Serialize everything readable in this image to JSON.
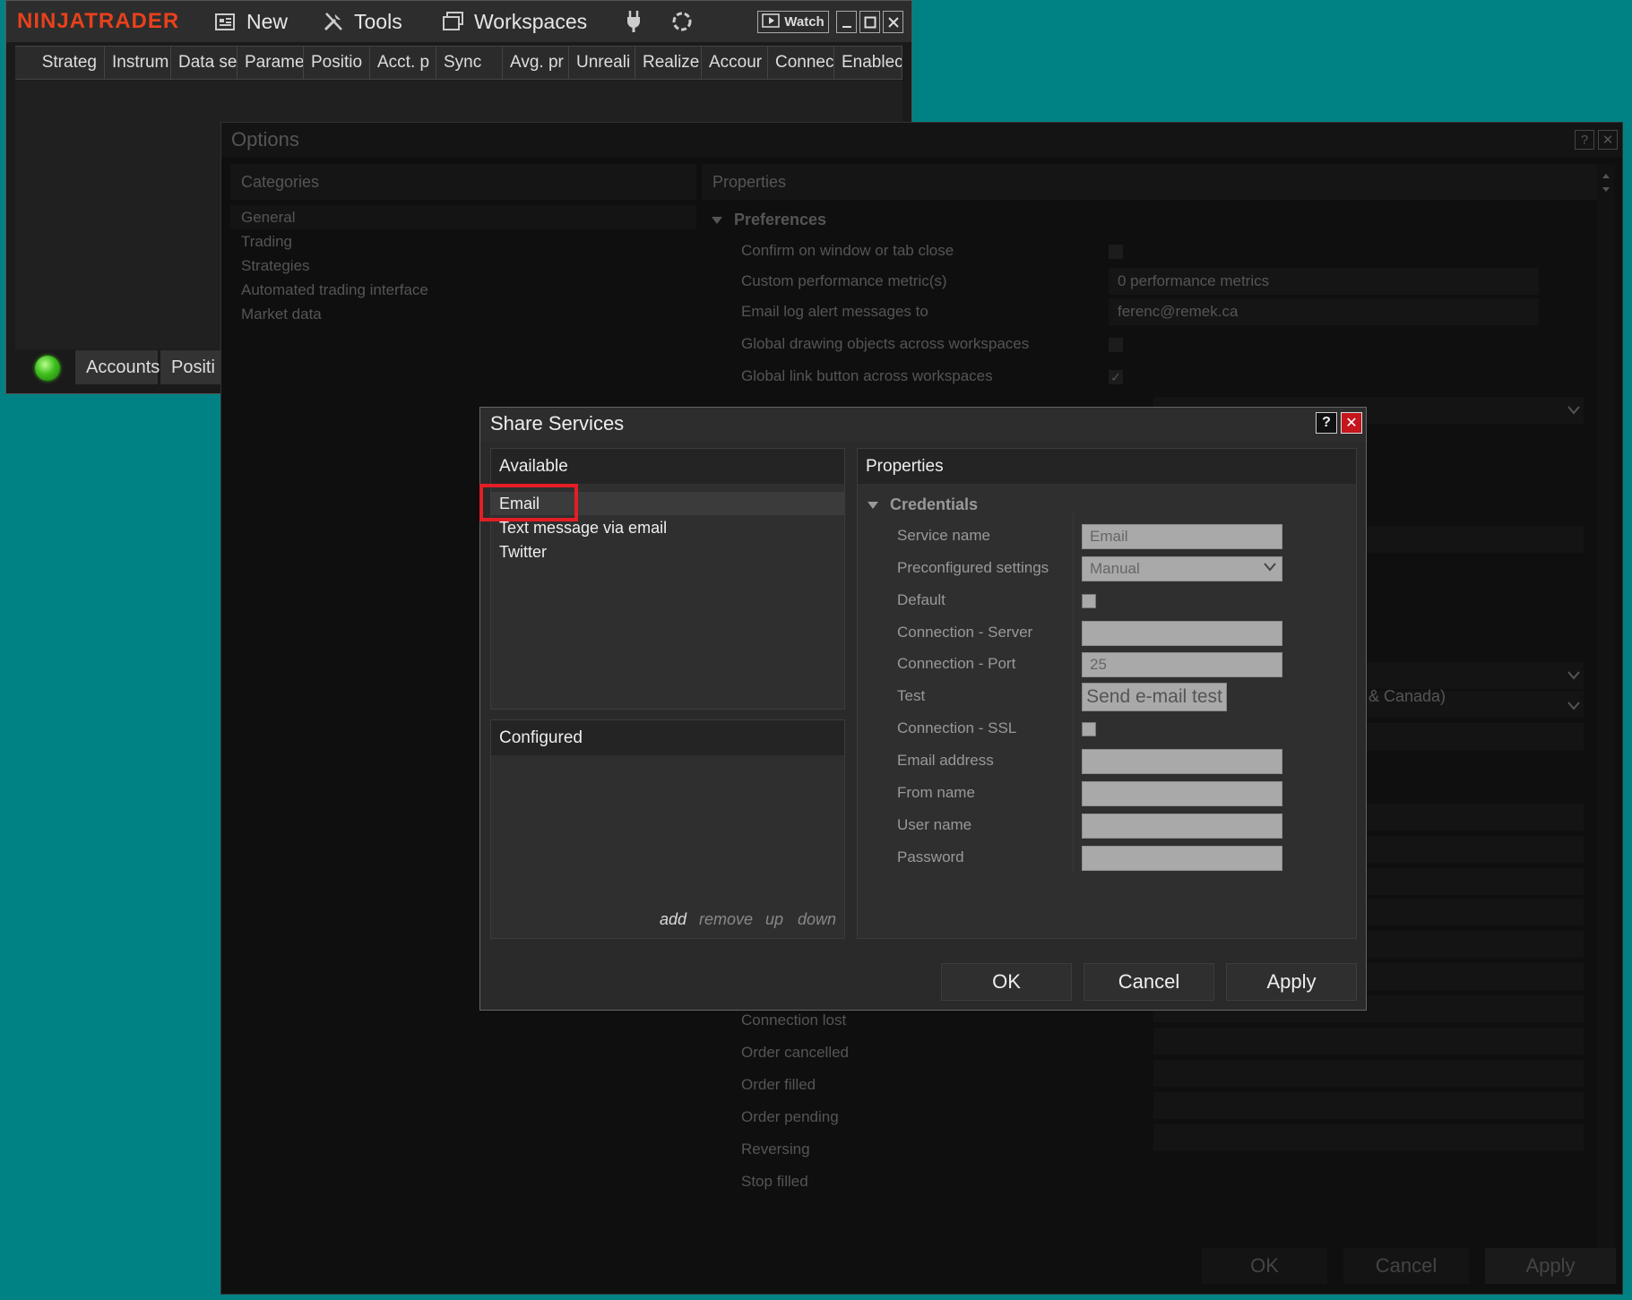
{
  "control_center": {
    "logo": "NINJATRADER",
    "menu": {
      "new": "New",
      "tools": "Tools",
      "workspaces": "Workspaces",
      "watch": "Watch"
    },
    "columns": [
      "Strateg",
      "Instrum",
      "Data se",
      "Parame",
      "Positio",
      "Acct. p",
      "Sync",
      "Avg. pr",
      "Unreali",
      "Realize",
      "Accour",
      "Connec",
      "Enablec"
    ],
    "tabs": [
      "Accounts",
      "Positi"
    ],
    "status_color": "#3fbf1f"
  },
  "options": {
    "title": "Options",
    "help": "?",
    "close": "✕",
    "categories_header": "Categories",
    "categories": [
      "General",
      "Trading",
      "Strategies",
      "Automated trading interface",
      "Market data"
    ],
    "properties_header": "Properties",
    "preferences_group": "Preferences",
    "rows": [
      {
        "label": "Confirm on window or tab close",
        "value": "",
        "type": "check",
        "checked": false
      },
      {
        "label": "Custom performance metric(s)",
        "value": "0 performance metrics",
        "type": "text"
      },
      {
        "label": "Email log alert messages to",
        "value": "ferenc@remek.ca",
        "type": "text"
      },
      {
        "label": "Global drawing objects across workspaces",
        "value": "",
        "type": "check",
        "checked": false
      },
      {
        "label": "Global link button across workspaces",
        "value": "✓",
        "type": "check",
        "checked": true
      }
    ],
    "timezone_fragment": "& Canada)",
    "lower_labels": [
      "Connection lost",
      "Order cancelled",
      "Order filled",
      "Order pending",
      "Reversing",
      "Stop filled"
    ],
    "buttons": {
      "ok": "OK",
      "cancel": "Cancel",
      "apply": "Apply"
    }
  },
  "share_services": {
    "title": "Share Services",
    "help": "?",
    "close": "✕",
    "available_header": "Available",
    "available_items": [
      "Email",
      "Text message via email",
      "Twitter"
    ],
    "selected_item": "Email",
    "highlight_color": "#e31e24",
    "configured_header": "Configured",
    "configured_links": {
      "add": "add",
      "remove": "remove",
      "up": "up",
      "down": "down"
    },
    "properties_header": "Properties",
    "credentials_group": "Credentials",
    "fields": {
      "service_name": {
        "label": "Service name",
        "value": "Email"
      },
      "preconfigured": {
        "label": "Preconfigured settings",
        "value": "Manual"
      },
      "default": {
        "label": "Default"
      },
      "server": {
        "label": "Connection - Server",
        "value": ""
      },
      "port": {
        "label": "Connection - Port",
        "value": "25"
      },
      "test": {
        "label": "Test",
        "button": "Send e-mail test"
      },
      "ssl": {
        "label": "Connection - SSL"
      },
      "email_address": {
        "label": "Email address",
        "value": ""
      },
      "from_name": {
        "label": "From name",
        "value": ""
      },
      "user_name": {
        "label": "User name",
        "value": ""
      },
      "password": {
        "label": "Password",
        "value": ""
      }
    },
    "buttons": {
      "ok": "OK",
      "cancel": "Cancel",
      "apply": "Apply"
    }
  }
}
